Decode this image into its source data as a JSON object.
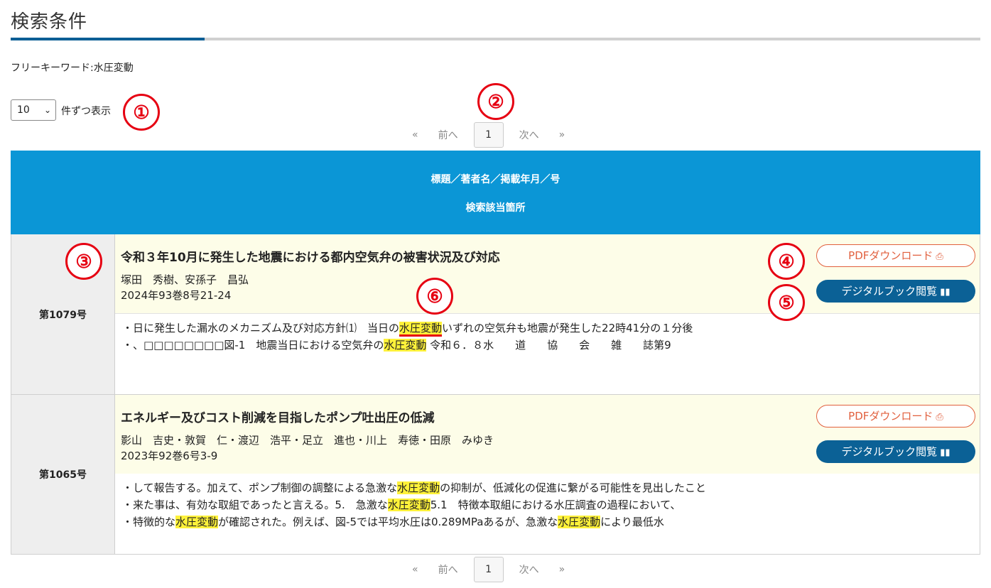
{
  "page_title": "検索条件",
  "keyword": {
    "label": "フリーキーワード:",
    "value": "水圧変動"
  },
  "per_page": {
    "selected": "10",
    "label": "件ずつ表示"
  },
  "pager": {
    "first": "«",
    "prev": "前へ",
    "current": "1",
    "next": "次へ",
    "last": "»"
  },
  "table_header": {
    "line1": "標題／著者名／掲載年月／号",
    "line2": "検索該当箇所"
  },
  "markers": [
    "①",
    "②",
    "③",
    "④",
    "⑤",
    "⑥"
  ],
  "buttons": {
    "pdf": "PDFダウンロード",
    "book": "デジタルブック閲覧"
  },
  "records": [
    {
      "issue": "第1079号",
      "title": "令和３年10月に発生した地震における都内空気弁の被害状況及び対応",
      "authors": "塚田　秀樹、安孫子　昌弘",
      "pub": "2024年93巻8号21-24",
      "snippets": [
        [
          "・日に発生した漏水のメカニズム及び対応方針⑴　当日の",
          "水圧変動",
          "いずれの空気弁も地震が発生した22時41分の１分後"
        ],
        [
          "・、□□□□□□□□図-1　地震当日における空気弁の",
          "水圧変動",
          " 令和６．８水　　道　　協　　会　　雑　　誌第9"
        ]
      ]
    },
    {
      "issue": "第1065号",
      "title": "エネルギー及びコスト削減を目指したポンプ吐出圧の低減",
      "authors": "影山　吉史・敦賀　仁・渡辺　浩平・足立　進也・川上　寿徳・田原　みゆき",
      "pub": "2023年92巻6号3-9",
      "snippets": [
        [
          "・して報告する。加えて、ポンプ制御の調整による急激な",
          "水圧変動",
          "の抑制が、低減化の促進に繋がる可能性を見出したこと"
        ],
        [
          "・来た事は、有効な取組であったと言える。5.　急激な",
          "水圧変動",
          "5.1　特徴本取組における水圧調査の過程において、"
        ],
        [
          "・特徴的な",
          "水圧変動",
          "が確認された。例えば、図-5では平均水圧は0.289MPaあるが、急激な",
          "水圧変動",
          "により最低水"
        ]
      ]
    }
  ]
}
